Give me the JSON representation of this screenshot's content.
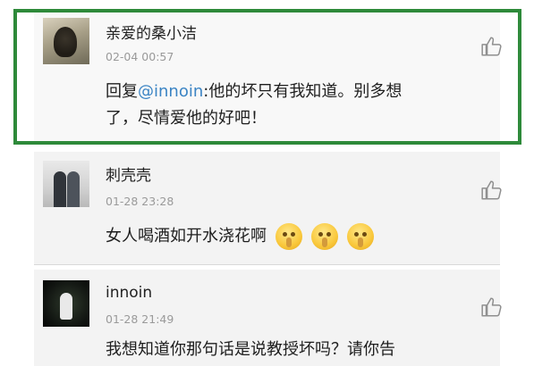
{
  "comments": [
    {
      "name": "亲爱的桑小洁",
      "time": "02-04 00:57",
      "reply_prefix": "回复",
      "mention": "@innoin",
      "text_line1_rest": ":他的坏只有我知道。别多想",
      "text_line2": "了，尽情爱他的好吧！"
    },
    {
      "name": "刺壳壳",
      "time": "01-28 23:28",
      "text": "女人喝酒如开水浇花啊"
    },
    {
      "name": "innoin",
      "time": "01-28 21:49",
      "text": "我想知道你那句话是说教授坏吗？请你告"
    }
  ],
  "icons": {
    "like": "thumbs-up-icon",
    "emoji": "shush-emoji-icon"
  },
  "colors": {
    "highlight_border": "#2e8a3a",
    "mention": "#3b84c4",
    "timestamp": "#9a9a9a"
  }
}
